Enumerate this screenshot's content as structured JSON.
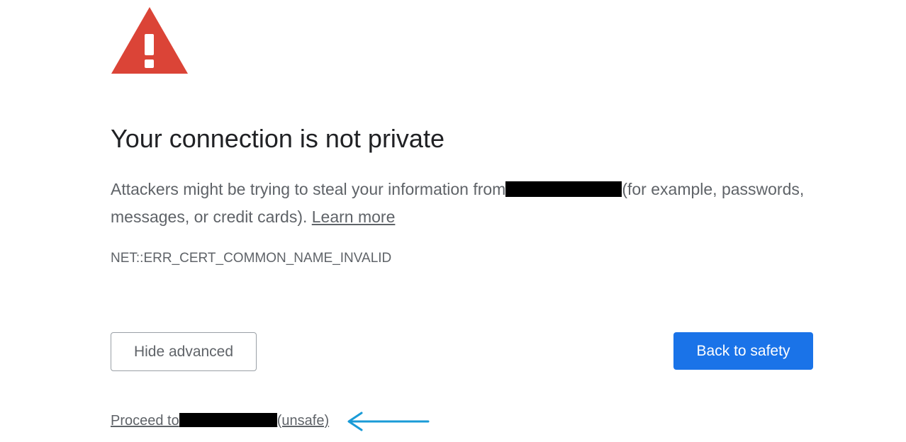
{
  "page": {
    "title": "Your connection is not private",
    "description_part1": "Attackers might be trying to steal your information from",
    "description_part2": "(for example, passwords, messages, or credit cards).",
    "learn_more_label": "Learn more",
    "error_code": "NET::ERR_CERT_COMMON_NAME_INVALID"
  },
  "buttons": {
    "hide_advanced_label": "Hide advanced",
    "back_to_safety_label": "Back to safety"
  },
  "proceed": {
    "prefix": "Proceed to",
    "suffix": "(unsafe)"
  },
  "icons": {
    "warning": "warning-triangle-icon",
    "annotation_arrow": "arrow-left-icon"
  },
  "colors": {
    "warning_red": "#db4437",
    "primary_blue": "#1a73e8",
    "annotation_arrow": "#1a9bd7",
    "title_text": "#202124",
    "body_text": "#5f6368"
  }
}
